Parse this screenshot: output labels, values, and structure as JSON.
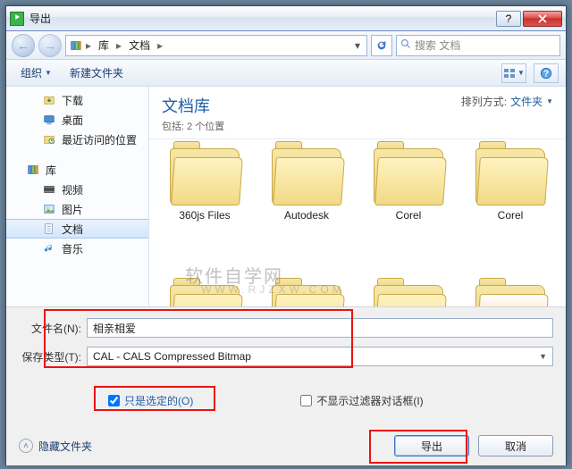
{
  "title": "导出",
  "breadcrumb": {
    "root": "库",
    "sub": "文档"
  },
  "search": {
    "placeholder": "搜索 文档"
  },
  "toolbar": {
    "organize": "组织",
    "newfolder": "新建文件夹"
  },
  "sidebar": {
    "items": [
      {
        "label": "下载"
      },
      {
        "label": "桌面"
      },
      {
        "label": "最近访问的位置"
      }
    ],
    "lib_label": "库",
    "libs": [
      {
        "label": "视频"
      },
      {
        "label": "图片"
      },
      {
        "label": "文档"
      },
      {
        "label": "音乐"
      }
    ]
  },
  "library": {
    "title": "文档库",
    "subtitle": "包括: 2 个位置",
    "sort_label": "排列方式:",
    "sort_value": "文件夹"
  },
  "files": [
    {
      "name": "360js Files"
    },
    {
      "name": "Autodesk"
    },
    {
      "name": "Corel"
    },
    {
      "name": "Corel"
    }
  ],
  "form": {
    "filename_label": "文件名(N):",
    "filename_value": "相亲相爱",
    "type_label": "保存类型(T):",
    "type_value": "CAL - CALS Compressed Bitmap",
    "selected_only": "只是选定的(O)",
    "no_filter_dialog": "不显示过滤器对话框(I)",
    "hide_folders": "隐藏文件夹",
    "export_btn": "导出",
    "cancel_btn": "取消"
  },
  "watermark": {
    "l1": "软件自学网",
    "l2": "WWW.RJZXW.COM"
  }
}
